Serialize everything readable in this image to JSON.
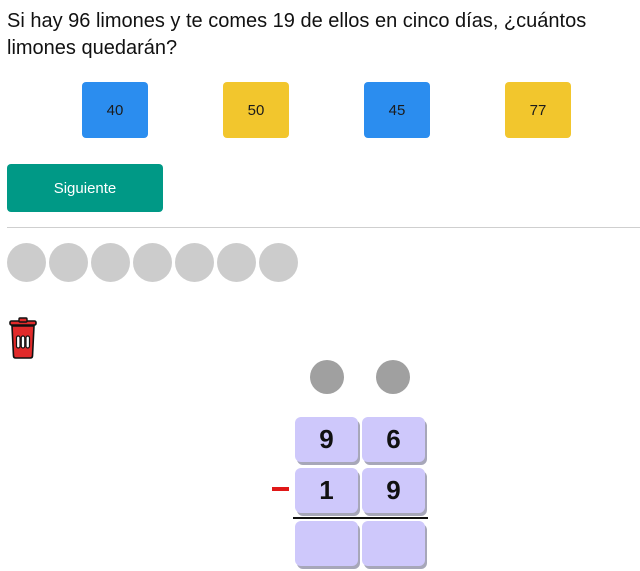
{
  "question": {
    "text": "Si hay 96 limones y te comes 19 de ellos en cinco días, ¿cuántos limones quedarán?"
  },
  "answers": [
    {
      "label": "40",
      "color": "#2b8def"
    },
    {
      "label": "50",
      "color": "#f2c62d"
    },
    {
      "label": "45",
      "color": "#2b8def"
    },
    {
      "label": "77",
      "color": "#f2c62d"
    }
  ],
  "next_button": {
    "label": "Siguiente",
    "color": "#009986"
  },
  "progress": {
    "total": 7,
    "completed": 0,
    "dot_color": "#cccccc"
  },
  "trash": {
    "icon": "trash-icon",
    "color": "#e12a2a"
  },
  "subtraction": {
    "carry_color": "#a0a0a0",
    "cell_color": "#cec8fb",
    "minuend": [
      "9",
      "6"
    ],
    "subtrahend": [
      "1",
      "9"
    ],
    "result": [
      "",
      ""
    ],
    "operator_color": "#e01818"
  }
}
